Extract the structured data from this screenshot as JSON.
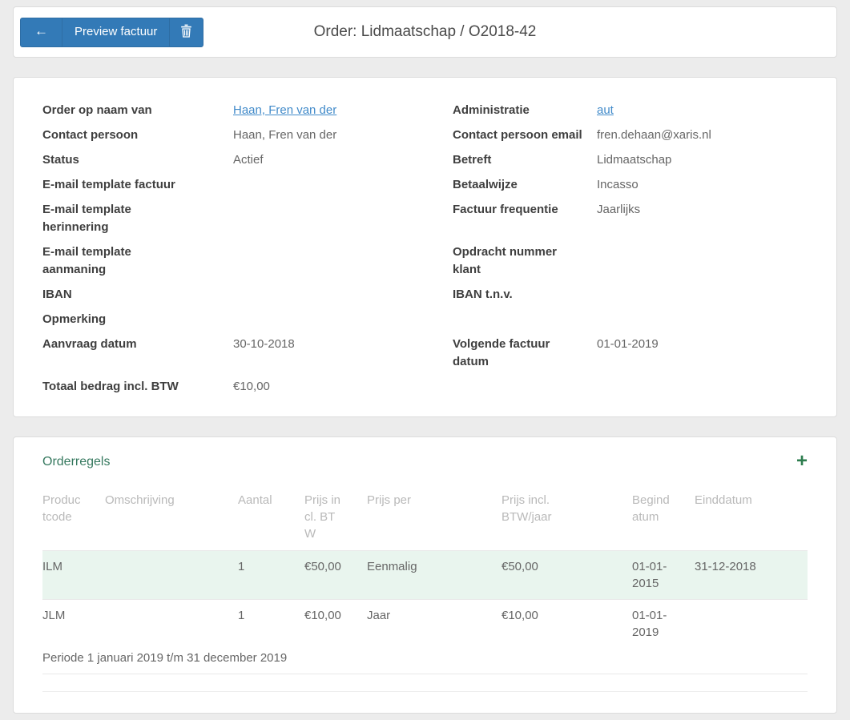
{
  "toolbar": {
    "back_icon": "←",
    "preview_button": "Preview factuur",
    "title": "Order: Lidmaatschap / O2018-42"
  },
  "details": {
    "rows": [
      {
        "left_label": "Order op naam van",
        "left_value": "Haan, Fren van der",
        "left_is_link": true,
        "right_label": "Administratie",
        "right_value": "aut",
        "right_is_link": true
      },
      {
        "left_label": "Contact persoon",
        "left_value": "Haan, Fren van der",
        "left_is_link": false,
        "right_label": "Contact persoon email",
        "right_value": "fren.dehaan@xaris.nl",
        "right_is_link": false
      },
      {
        "left_label": "Status",
        "left_value": "Actief",
        "left_is_link": false,
        "right_label": "Betreft",
        "right_value": "Lidmaatschap",
        "right_is_link": false
      },
      {
        "left_label": "E-mail template factuur",
        "left_value": "",
        "left_is_link": false,
        "right_label": "Betaalwijze",
        "right_value": "Incasso",
        "right_is_link": false
      },
      {
        "left_label": "E-mail template herinnering",
        "left_value": "",
        "left_is_link": false,
        "right_label": "Factuur frequentie",
        "right_value": "Jaarlijks",
        "right_is_link": false
      },
      {
        "left_label": "E-mail template aanmaning",
        "left_value": "",
        "left_is_link": false,
        "right_label": "Opdracht nummer klant",
        "right_value": "",
        "right_is_link": false
      },
      {
        "left_label": "IBAN",
        "left_value": "",
        "left_is_link": false,
        "right_label": "IBAN t.n.v.",
        "right_value": "",
        "right_is_link": false
      },
      {
        "left_label": "Opmerking",
        "left_value": "",
        "left_is_link": false,
        "right_label": "",
        "right_value": "",
        "right_is_link": false
      },
      {
        "left_label": "Aanvraag datum",
        "left_value": "30-10-2018",
        "left_is_link": false,
        "right_label": "Volgende factuur datum",
        "right_value": "01-01-2019",
        "right_is_link": false
      },
      {
        "left_label": "Totaal bedrag incl. BTW",
        "left_value": "€10,00",
        "left_is_link": false,
        "right_label": "",
        "right_value": "",
        "right_is_link": false
      }
    ]
  },
  "orderregels": {
    "title": "Orderregels",
    "add_icon": "+",
    "headers": [
      "Productcode",
      "Omschrijving",
      "Aantal",
      "Prijs incl. BTW",
      "Prijs per",
      "Prijs incl. BTW/jaar",
      "Begindatum",
      "Einddatum"
    ],
    "rows": [
      {
        "productcode": "ILM",
        "omschrijving": "",
        "aantal": "1",
        "prijs_incl_btw": "€50,00",
        "prijs_per": "Eenmalig",
        "prijs_incl_btw_jaar": "€50,00",
        "begindatum": "01-01-2015",
        "einddatum": "31-12-2018",
        "highlight": true
      },
      {
        "productcode": "JLM",
        "omschrijving": "",
        "aantal": "1",
        "prijs_incl_btw": "€10,00",
        "prijs_per": "Jaar",
        "prijs_incl_btw_jaar": "€10,00",
        "begindatum": "01-01-2019",
        "einddatum": "",
        "highlight": false
      }
    ],
    "note": "Periode 1 januari 2019 t/m 31 december 2019"
  },
  "colors": {
    "button-blue": "#337ab7",
    "button-blue-border": "#2e6da4",
    "link-blue": "#428bca",
    "section-green": "#36795f",
    "plus-green": "#2e7d4f",
    "row-highlight": "#e9f5ee"
  }
}
